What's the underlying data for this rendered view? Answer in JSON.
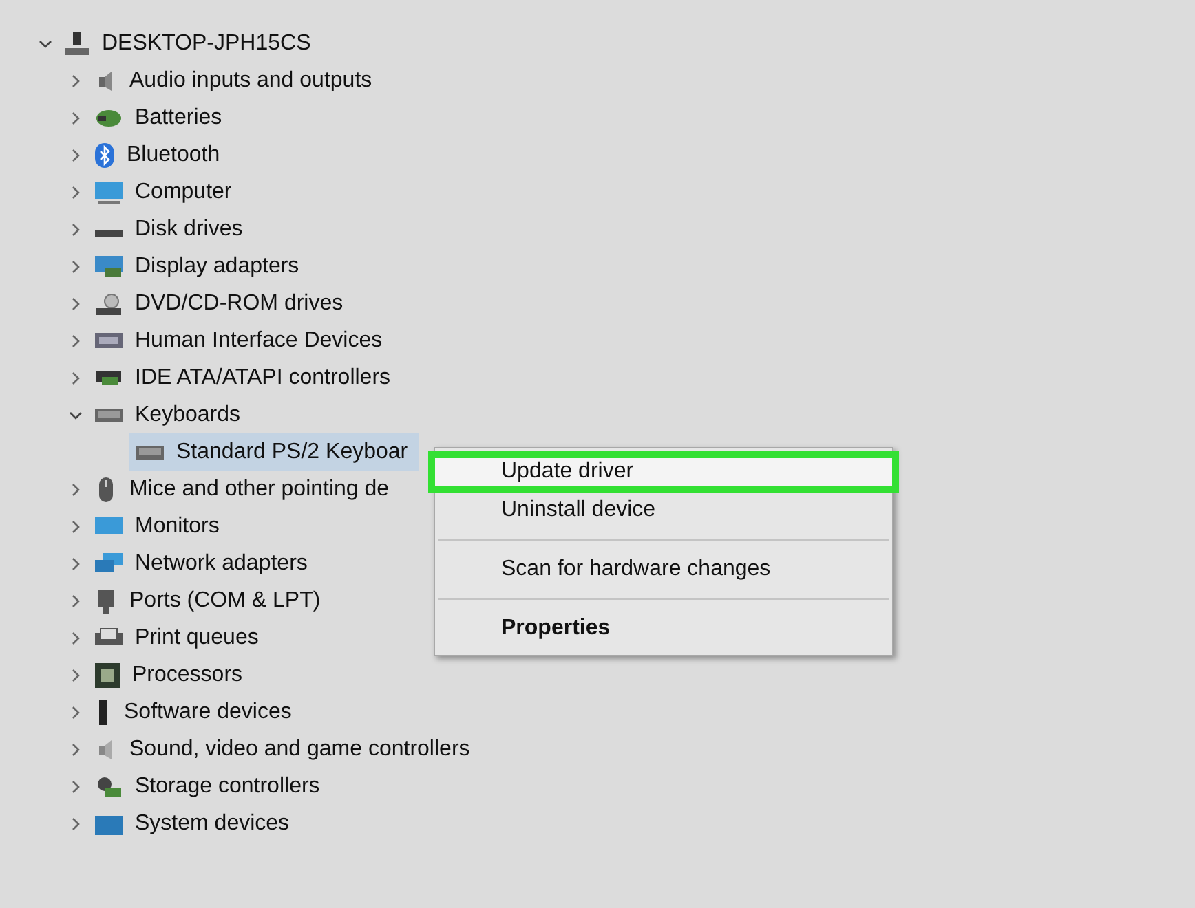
{
  "tree": {
    "label": "DESKTOP-JPH15CS",
    "expanded": true,
    "children": [
      {
        "label": "Audio inputs and outputs",
        "expanded": false
      },
      {
        "label": "Batteries",
        "expanded": false
      },
      {
        "label": "Bluetooth",
        "expanded": false
      },
      {
        "label": "Computer",
        "expanded": false
      },
      {
        "label": "Disk drives",
        "expanded": false
      },
      {
        "label": "Display adapters",
        "expanded": false
      },
      {
        "label": "DVD/CD-ROM drives",
        "expanded": false
      },
      {
        "label": "Human Interface Devices",
        "expanded": false
      },
      {
        "label": "IDE ATA/ATAPI controllers",
        "expanded": false
      },
      {
        "label": "Keyboards",
        "expanded": true,
        "children": [
          {
            "label": "Standard PS/2 Keyboar",
            "selected": true
          }
        ]
      },
      {
        "label": "Mice and other pointing de",
        "expanded": false
      },
      {
        "label": "Monitors",
        "expanded": false
      },
      {
        "label": "Network adapters",
        "expanded": false
      },
      {
        "label": "Ports (COM & LPT)",
        "expanded": false
      },
      {
        "label": "Print queues",
        "expanded": false
      },
      {
        "label": "Processors",
        "expanded": false
      },
      {
        "label": "Software devices",
        "expanded": false
      },
      {
        "label": "Sound, video and game controllers",
        "expanded": false
      },
      {
        "label": "Storage controllers",
        "expanded": false
      },
      {
        "label": "System devices",
        "expanded": false
      }
    ]
  },
  "context_menu": {
    "items": [
      {
        "kind": "item",
        "label": "Update driver",
        "selected": true,
        "bold": false
      },
      {
        "kind": "item",
        "label": "Uninstall device",
        "selected": false,
        "bold": false
      },
      {
        "kind": "separator"
      },
      {
        "kind": "item",
        "label": "Scan for hardware changes",
        "selected": false,
        "bold": false
      },
      {
        "kind": "separator"
      },
      {
        "kind": "item",
        "label": "Properties",
        "selected": false,
        "bold": true
      }
    ]
  }
}
